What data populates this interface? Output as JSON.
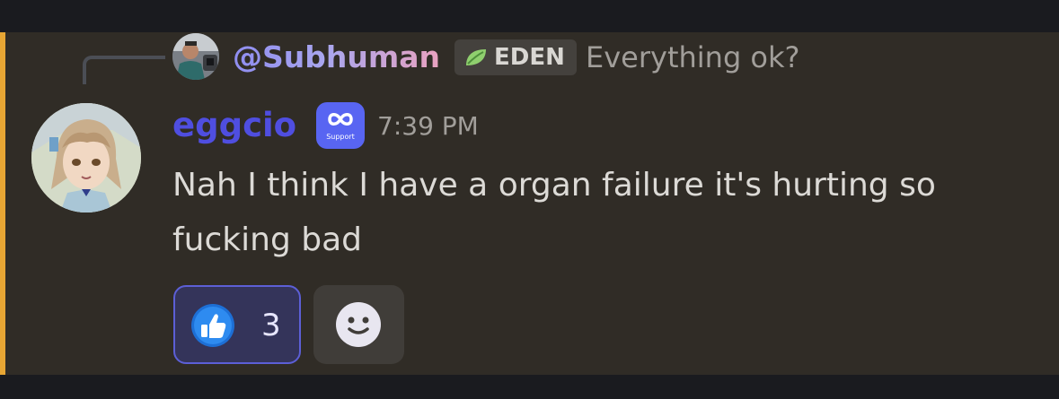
{
  "reply": {
    "author": "@Subhuman",
    "guild_tag": "EDEN",
    "content": "Everything ok?",
    "avatar_icon": "user-avatar-photo",
    "tag_icon": "leaf-icon"
  },
  "message": {
    "author": "eggcio",
    "app_badge_label": "Support",
    "app_badge_icon": "infinity-icon",
    "timestamp": "7:39 PM",
    "content": "Nah I think I have a organ failure it's hurting so fucking bad",
    "avatar_icon": "anime-avatar"
  },
  "reactions": [
    {
      "emoji": "thumbs-up-icon",
      "count": "3",
      "active": true
    }
  ],
  "add_reaction": {
    "icon": "smiley-icon"
  },
  "colors": {
    "message_bg": "#302c26",
    "highlight_bar": "#e7a634",
    "author_color": "#4f4ee0",
    "app_badge_bg": "#5865f2",
    "reaction_border": "#5c5fd6"
  }
}
